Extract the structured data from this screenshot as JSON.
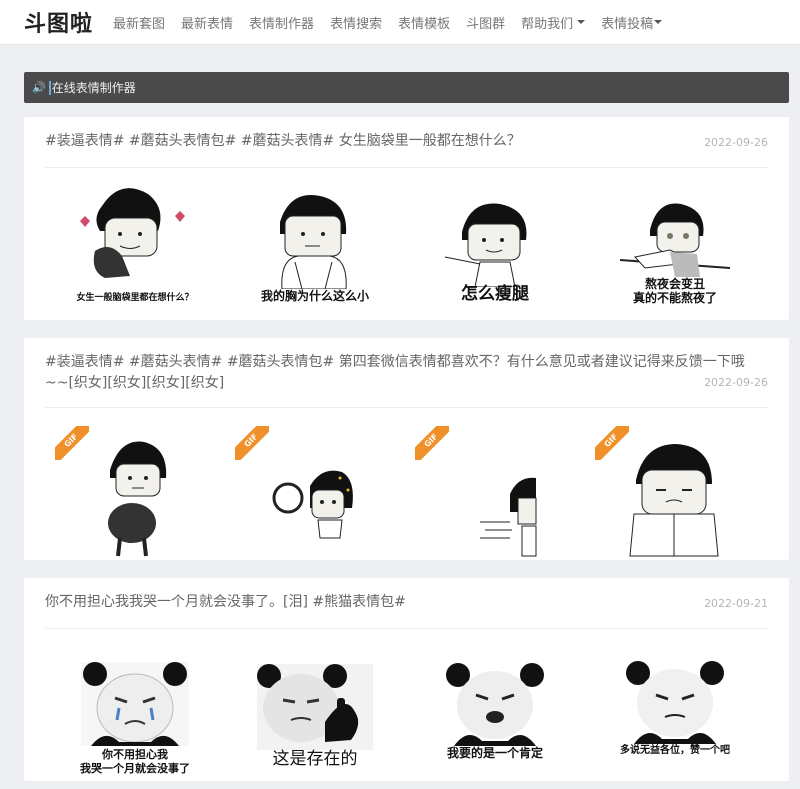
{
  "site": {
    "logo": "斗图啦"
  },
  "nav": {
    "items": [
      {
        "label": "最新套图"
      },
      {
        "label": "最新表情"
      },
      {
        "label": "表情制作器"
      },
      {
        "label": "表情搜索"
      },
      {
        "label": "表情模板"
      },
      {
        "label": "斗图群"
      },
      {
        "label": "帮助我们"
      },
      {
        "label": "表情投稿"
      }
    ]
  },
  "notice": {
    "icon": "speaker-icon",
    "text": "在线表情制作器"
  },
  "cards": [
    {
      "title": "#装逼表情# #蘑菇头表情包# #蘑菇头表情# 女生脑袋里一般都在想什么？",
      "date": "2022-09-26",
      "captions": [
        "女生一般脑袋里都在想什么？",
        "我的胸为什么这么小",
        "怎么瘦腿",
        "熬夜会变丑",
        "真的不能熬夜了"
      ]
    },
    {
      "title": "#装逼表情# #蘑菇头表情# #蘑菇头表情包# 第四套微信表情都喜欢不？有什么意见或者建议记得来反馈一下哦~~[织女][织女][织女][织女]",
      "date": "2022-09-26",
      "badge": "GIF"
    },
    {
      "title": "你不用担心我我哭一个月就会没事了。[泪] #熊猫表情包#",
      "date": "2022-09-21",
      "captions": [
        "你不用担心我",
        "我哭一个月就会没事了",
        "这是存在的",
        "我要的是一个肯定",
        "多说无益各位，赞一个吧"
      ]
    }
  ],
  "colors": {
    "notice_bg": "#4a4a4a",
    "gif_badge": "#f0902a",
    "page_bg": "#edeff2"
  }
}
